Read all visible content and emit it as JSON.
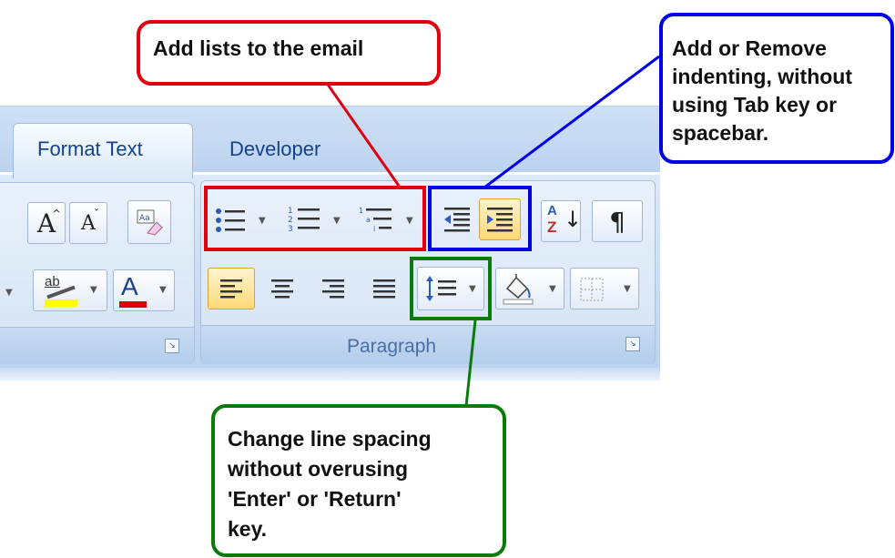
{
  "ribbon": {
    "tabs": [
      {
        "label": "Format Text",
        "active": true
      },
      {
        "label": "Developer",
        "active": false
      }
    ],
    "groups": {
      "paragraph": {
        "label": "Paragraph"
      }
    },
    "buttons": {
      "grow_font": "A",
      "shrink_font": "A",
      "font_color": "A",
      "sort": "Z",
      "sort_top": "A",
      "show_marks": "¶",
      "text_highlight": "ab"
    },
    "launcher_glyph": "↘"
  },
  "callouts": {
    "lists": {
      "text": "Add lists to the email",
      "color": "#e0000f"
    },
    "indent": {
      "lines": [
        "Add or Remove",
        "indenting, without",
        "using Tab key or",
        "spacebar."
      ],
      "color": "#0000e6"
    },
    "spacing": {
      "lines": [
        "Change line spacing",
        "without overusing",
        "'Enter' or 'Return'",
        "key."
      ],
      "color": "#0a7a0a"
    }
  }
}
